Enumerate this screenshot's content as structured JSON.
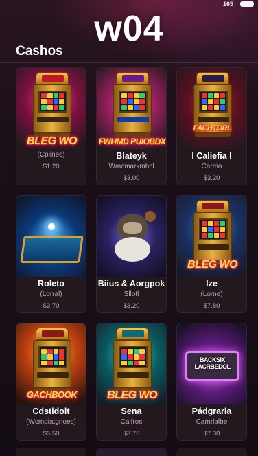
{
  "status": {
    "time": "165"
  },
  "app_title": "w04",
  "section_title": "Cashos",
  "cards": [
    {
      "name": "",
      "subtitle": "(Cplines)",
      "price": "$1.20",
      "neon": "BLEG WO"
    },
    {
      "name": "Blateyk",
      "subtitle": "Wmcmarkmhcl",
      "price": "$3.00",
      "neon": "FWHMD PUIOBDX"
    },
    {
      "name": "I Caliefia I",
      "subtitle": "Carmo",
      "price": "$3.20",
      "neon": "FACHTORL"
    },
    {
      "name": "Roleto",
      "subtitle": "(Lorral)",
      "price": "$3.70",
      "neon": ""
    },
    {
      "name": "Biius & Aorgpok",
      "subtitle": "Sllotl",
      "price": "$3.20",
      "neon": ""
    },
    {
      "name": "Ize",
      "subtitle": "(Lorne)",
      "price": "$7.80",
      "neon": "BLEG WO"
    },
    {
      "name": "Cdstidolt",
      "subtitle": "(Wcmdiatgnoes)",
      "price": "$5.50",
      "neon": "GACHBOOK"
    },
    {
      "name": "Sena",
      "subtitle": "Calfros",
      "price": "$3.73",
      "neon": "BLEG WO"
    },
    {
      "name": "Pádgraria",
      "subtitle": "Camrlalbe",
      "price": "$7.30",
      "neon": "BACKSIX LACRBEDOL"
    }
  ],
  "colors": {
    "neon_text": "#ffe04a",
    "card_bg": "#24181f",
    "accent_pink": "#e03a8a"
  }
}
